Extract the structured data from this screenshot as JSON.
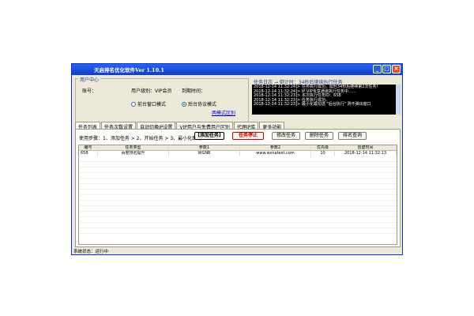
{
  "window": {
    "title": "天启排名优化软件Ver 1.10.1",
    "min": "_",
    "max": "□",
    "close": "×"
  },
  "user_center": {
    "title": "用户中心",
    "account_label": "账号：",
    "level_label": "用户级别：",
    "level_value": "VIP会员",
    "expire_label": "到期时间：",
    "mode_front": "前台窗口模式",
    "mode_back": "后台协议模式",
    "mode_selected": "后台协议模式",
    "mode_link": "两模式区别"
  },
  "log": {
    "title": "任务日志 → 倒计时：34秒后继续执行任务",
    "lines": [
      "2018-12-14 11:32:24]> 任务执行成功，延时34秒后继续第2次任务!",
      "2018-12-14 11:32:24]> IP:VIP专享通道执行任务中……",
      "2018-12-14 11:32:23]> 本次执行任务ID：658",
      "2018-12-14 11:32:23]> 任务执行成功。",
      "2018-12-14 11:32:23]> 最小化或勾选 \"后台执行\" 则不弹出窗口"
    ]
  },
  "tabs": [
    "任务列表",
    "任务次数设置",
    "自动切换IP设置",
    "VIP用户与免费用户区别",
    "代理IP库",
    "更多功能"
  ],
  "active_tab": "任务列表",
  "toolbar": {
    "usage": "使用步骤：1、添加任务 > 2、开始任务 > 3、最小化即可",
    "add": "【添加任务】",
    "stop": "任务停止",
    "edit": "修改任务",
    "delete": "删除任务",
    "rank": "排名查询"
  },
  "table": {
    "columns": [
      "编号",
      "任务类型",
      "参数1",
      "参数2",
      "优先级",
      "创建时间"
    ],
    "rows": [
      [
        "658",
        "百度排名提升",
        "WGNB",
        "www.wsnatext.com",
        "10",
        "2018-12-14 11:32:13"
      ]
    ]
  },
  "status_bar": "系统状态：运行中"
}
